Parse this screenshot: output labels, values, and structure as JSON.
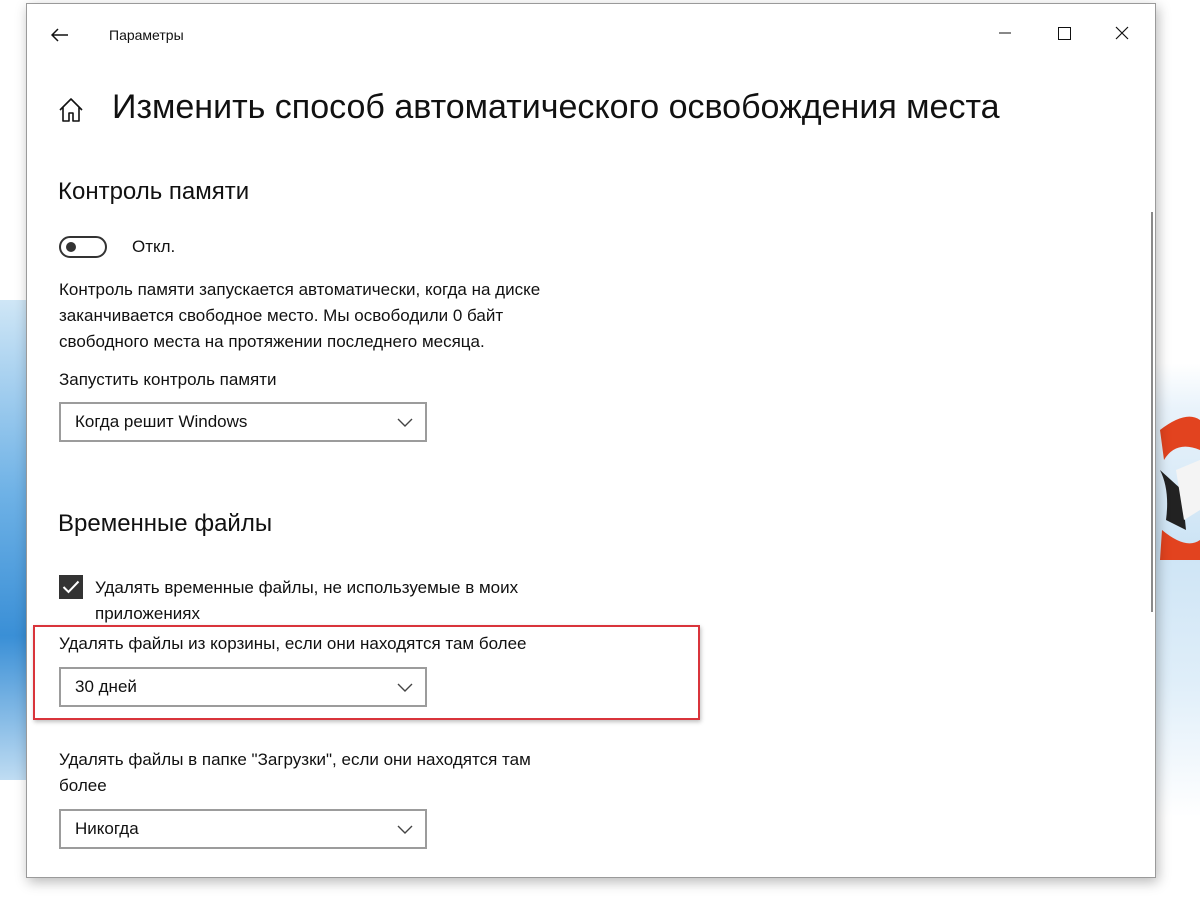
{
  "window": {
    "app_title": "Параметры"
  },
  "header": {
    "page_title": "Изменить способ автоматического освобождения места"
  },
  "storage_sense": {
    "section_title": "Контроль памяти",
    "toggle_state_label": "Откл.",
    "toggle_on": false,
    "description_lines": [
      "Контроль памяти запускается автоматически, когда на диске",
      "заканчивается свободное место. Мы освободили 0 байт",
      "свободного места на протяжении последнего месяца."
    ],
    "run_label": "Запустить контроль памяти",
    "run_value": "Когда решит Windows"
  },
  "temp_files": {
    "section_title": "Временные файлы",
    "delete_temp_checked": true,
    "delete_temp_label_lines": [
      "Удалять временные файлы, не используемые в моих",
      "приложениях"
    ],
    "recycle_label": "Удалять файлы из корзины, если они находятся там более",
    "recycle_value": "30 дней",
    "downloads_label_lines": [
      "Удалять файлы в папке \"Загрузки\", если они находятся там",
      "более"
    ],
    "downloads_value": "Никогда"
  },
  "colors": {
    "highlight": "#d9343b",
    "text": "#111111",
    "control_border": "#9c9c9c"
  },
  "icons": {
    "back": "arrow-left-icon",
    "home": "home-icon",
    "minimize": "minimize-icon",
    "maximize": "maximize-icon",
    "close": "close-icon",
    "chevron": "chevron-down-icon",
    "check": "checkmark-icon"
  }
}
